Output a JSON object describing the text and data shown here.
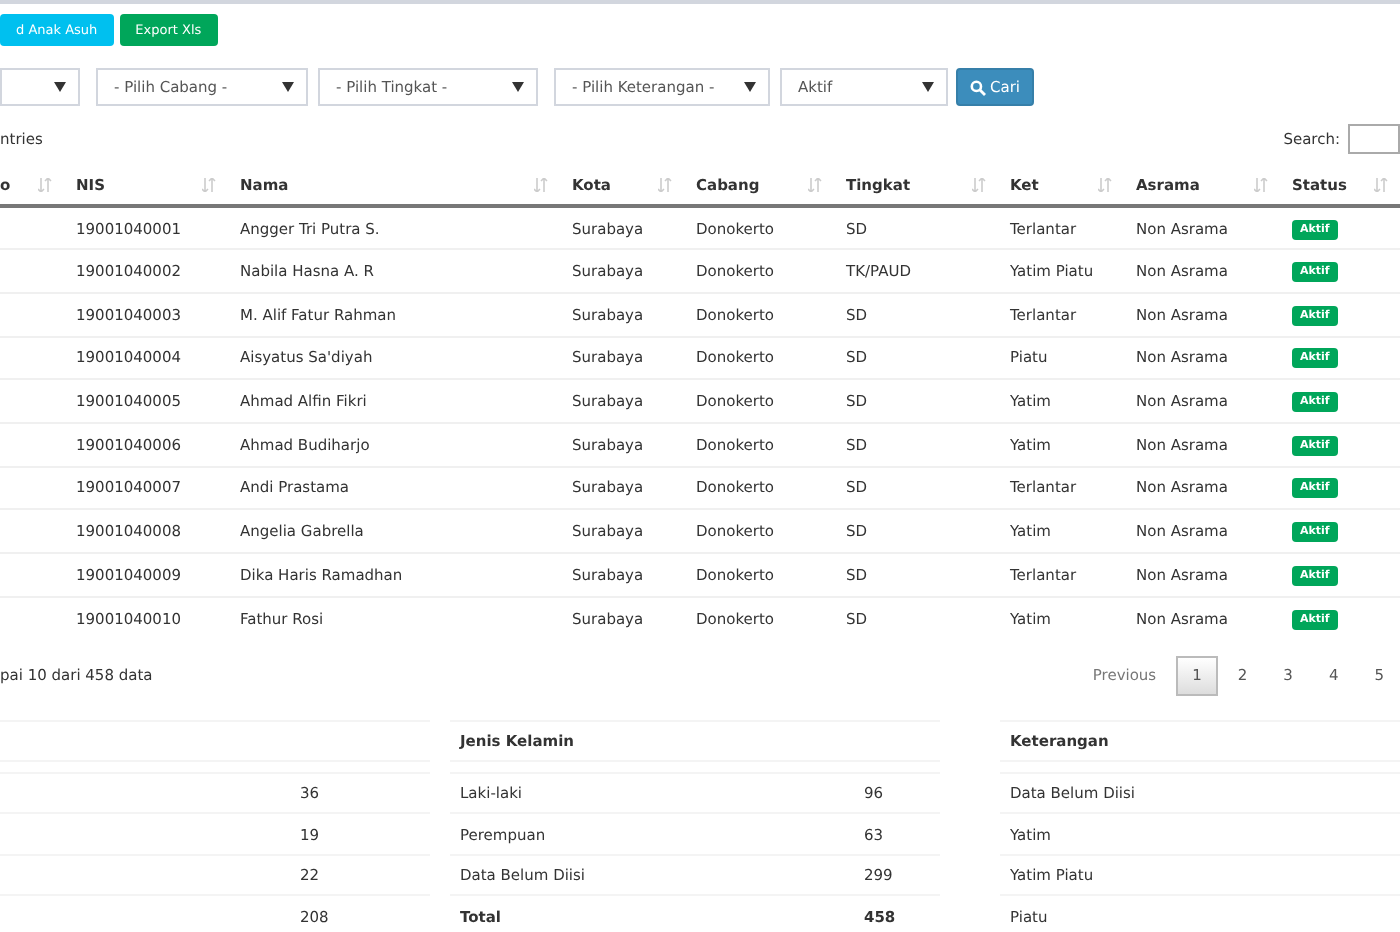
{
  "toolbar": {
    "buttons": [
      {
        "label": "d Anak Asuh",
        "kind": "info"
      },
      {
        "label": "Export Xls",
        "kind": "success"
      }
    ]
  },
  "filters": {
    "selects": [
      {
        "kind": "blank"
      },
      {
        "kind": "text",
        "placeholder": "- Pilih Cabang -"
      },
      {
        "kind": "text",
        "placeholder": "- Pilih Tingkat -"
      },
      {
        "kind": "text",
        "placeholder": "- Pilih Keterangan -"
      },
      {
        "kind": "text",
        "value": "Aktif"
      }
    ],
    "search_button": "Cari"
  },
  "length_text": "ntries",
  "search": {
    "label": "Search:"
  },
  "table": {
    "columns": [
      "o",
      "NIS",
      "Nama",
      "Kota",
      "Cabang",
      "Tingkat",
      "Ket",
      "Asrama",
      "Status"
    ],
    "rows": [
      {
        "nis": "19001040001",
        "nama": "Angger Tri Putra S.",
        "kota": "Surabaya",
        "cabang": "Donokerto",
        "tingkat": "SD",
        "ket": "Terlantar",
        "asrama": "Non Asrama",
        "status": "Aktif",
        "color": "#00a65a"
      },
      {
        "nis": "19001040002",
        "nama": "Nabila Hasna A. R",
        "kota": "Surabaya",
        "cabang": "Donokerto",
        "tingkat": "TK/PAUD",
        "ket": "Yatim Piatu",
        "asrama": "Non Asrama",
        "status": "Aktif",
        "color": "#00a65a"
      },
      {
        "nis": "19001040003",
        "nama": "M. Alif Fatur Rahman",
        "kota": "Surabaya",
        "cabang": "Donokerto",
        "tingkat": "SD",
        "ket": "Terlantar",
        "asrama": "Non Asrama",
        "status": "Aktif",
        "color": "#00a65a"
      },
      {
        "nis": "19001040004",
        "nama": "Aisyatus Sa'diyah",
        "kota": "Surabaya",
        "cabang": "Donokerto",
        "tingkat": "SD",
        "ket": "Piatu",
        "asrama": "Non Asrama",
        "status": "Aktif",
        "color": "#00a65a"
      },
      {
        "nis": "19001040005",
        "nama": "Ahmad Alfin Fikri",
        "kota": "Surabaya",
        "cabang": "Donokerto",
        "tingkat": "SD",
        "ket": "Yatim",
        "asrama": "Non Asrama",
        "status": "Aktif",
        "color": "#00a65a"
      },
      {
        "nis": "19001040006",
        "nama": "Ahmad Budiharjo",
        "kota": "Surabaya",
        "cabang": "Donokerto",
        "tingkat": "SD",
        "ket": "Yatim",
        "asrama": "Non Asrama",
        "status": "Aktif",
        "color": "#00a65a"
      },
      {
        "nis": "19001040007",
        "nama": "Andi Prastama",
        "kota": "Surabaya",
        "cabang": "Donokerto",
        "tingkat": "SD",
        "ket": "Terlantar",
        "asrama": "Non Asrama",
        "status": "Aktif",
        "color": "#00a65a"
      },
      {
        "nis": "19001040008",
        "nama": "Angelia Gabrella",
        "kota": "Surabaya",
        "cabang": "Donokerto",
        "tingkat": "SD",
        "ket": "Yatim",
        "asrama": "Non Asrama",
        "status": "Aktif",
        "color": "#00a65a"
      },
      {
        "nis": "19001040009",
        "nama": "Dika Haris Ramadhan",
        "kota": "Surabaya",
        "cabang": "Donokerto",
        "tingkat": "SD",
        "ket": "Terlantar",
        "asrama": "Non Asrama",
        "status": "Aktif",
        "color": "#00a65a"
      },
      {
        "nis": "19001040010",
        "nama": "Fathur Rosi",
        "kota": "Surabaya",
        "cabang": "Donokerto",
        "tingkat": "SD",
        "ket": "Yatim",
        "asrama": "Non Asrama",
        "status": "Aktif",
        "color": "#00a65a"
      }
    ]
  },
  "info": "pai 10 dari 458 data",
  "pagination": {
    "previous": "Previous",
    "pages": [
      {
        "label": "1",
        "selected": true
      },
      {
        "label": "2",
        "selected": false
      },
      {
        "label": "3",
        "selected": false
      },
      {
        "label": "4",
        "selected": false
      },
      {
        "label": "5",
        "selected": false
      }
    ]
  },
  "summary": [
    {
      "rows": [
        {
          "value": "36",
          "kind": "item"
        },
        {
          "value": "19",
          "kind": "item"
        },
        {
          "value": "22",
          "kind": "item"
        },
        {
          "value": "208",
          "kind": "item"
        }
      ]
    },
    {
      "title": "Jenis Kelamin",
      "rows": [
        {
          "label": "Laki-laki",
          "value": "96",
          "kind": "item"
        },
        {
          "label": "Perempuan",
          "value": "63",
          "kind": "item"
        },
        {
          "label": "Data Belum Diisi",
          "value": "299",
          "kind": "item"
        },
        {
          "label": "Total",
          "value": "458",
          "kind": "total"
        }
      ]
    },
    {
      "title": "Keterangan",
      "rows": [
        {
          "label": "Data Belum Diisi",
          "kind": "item"
        },
        {
          "label": "Yatim",
          "kind": "item"
        },
        {
          "label": "Yatim Piatu",
          "kind": "item"
        },
        {
          "label": "Piatu",
          "kind": "item"
        }
      ]
    }
  ]
}
